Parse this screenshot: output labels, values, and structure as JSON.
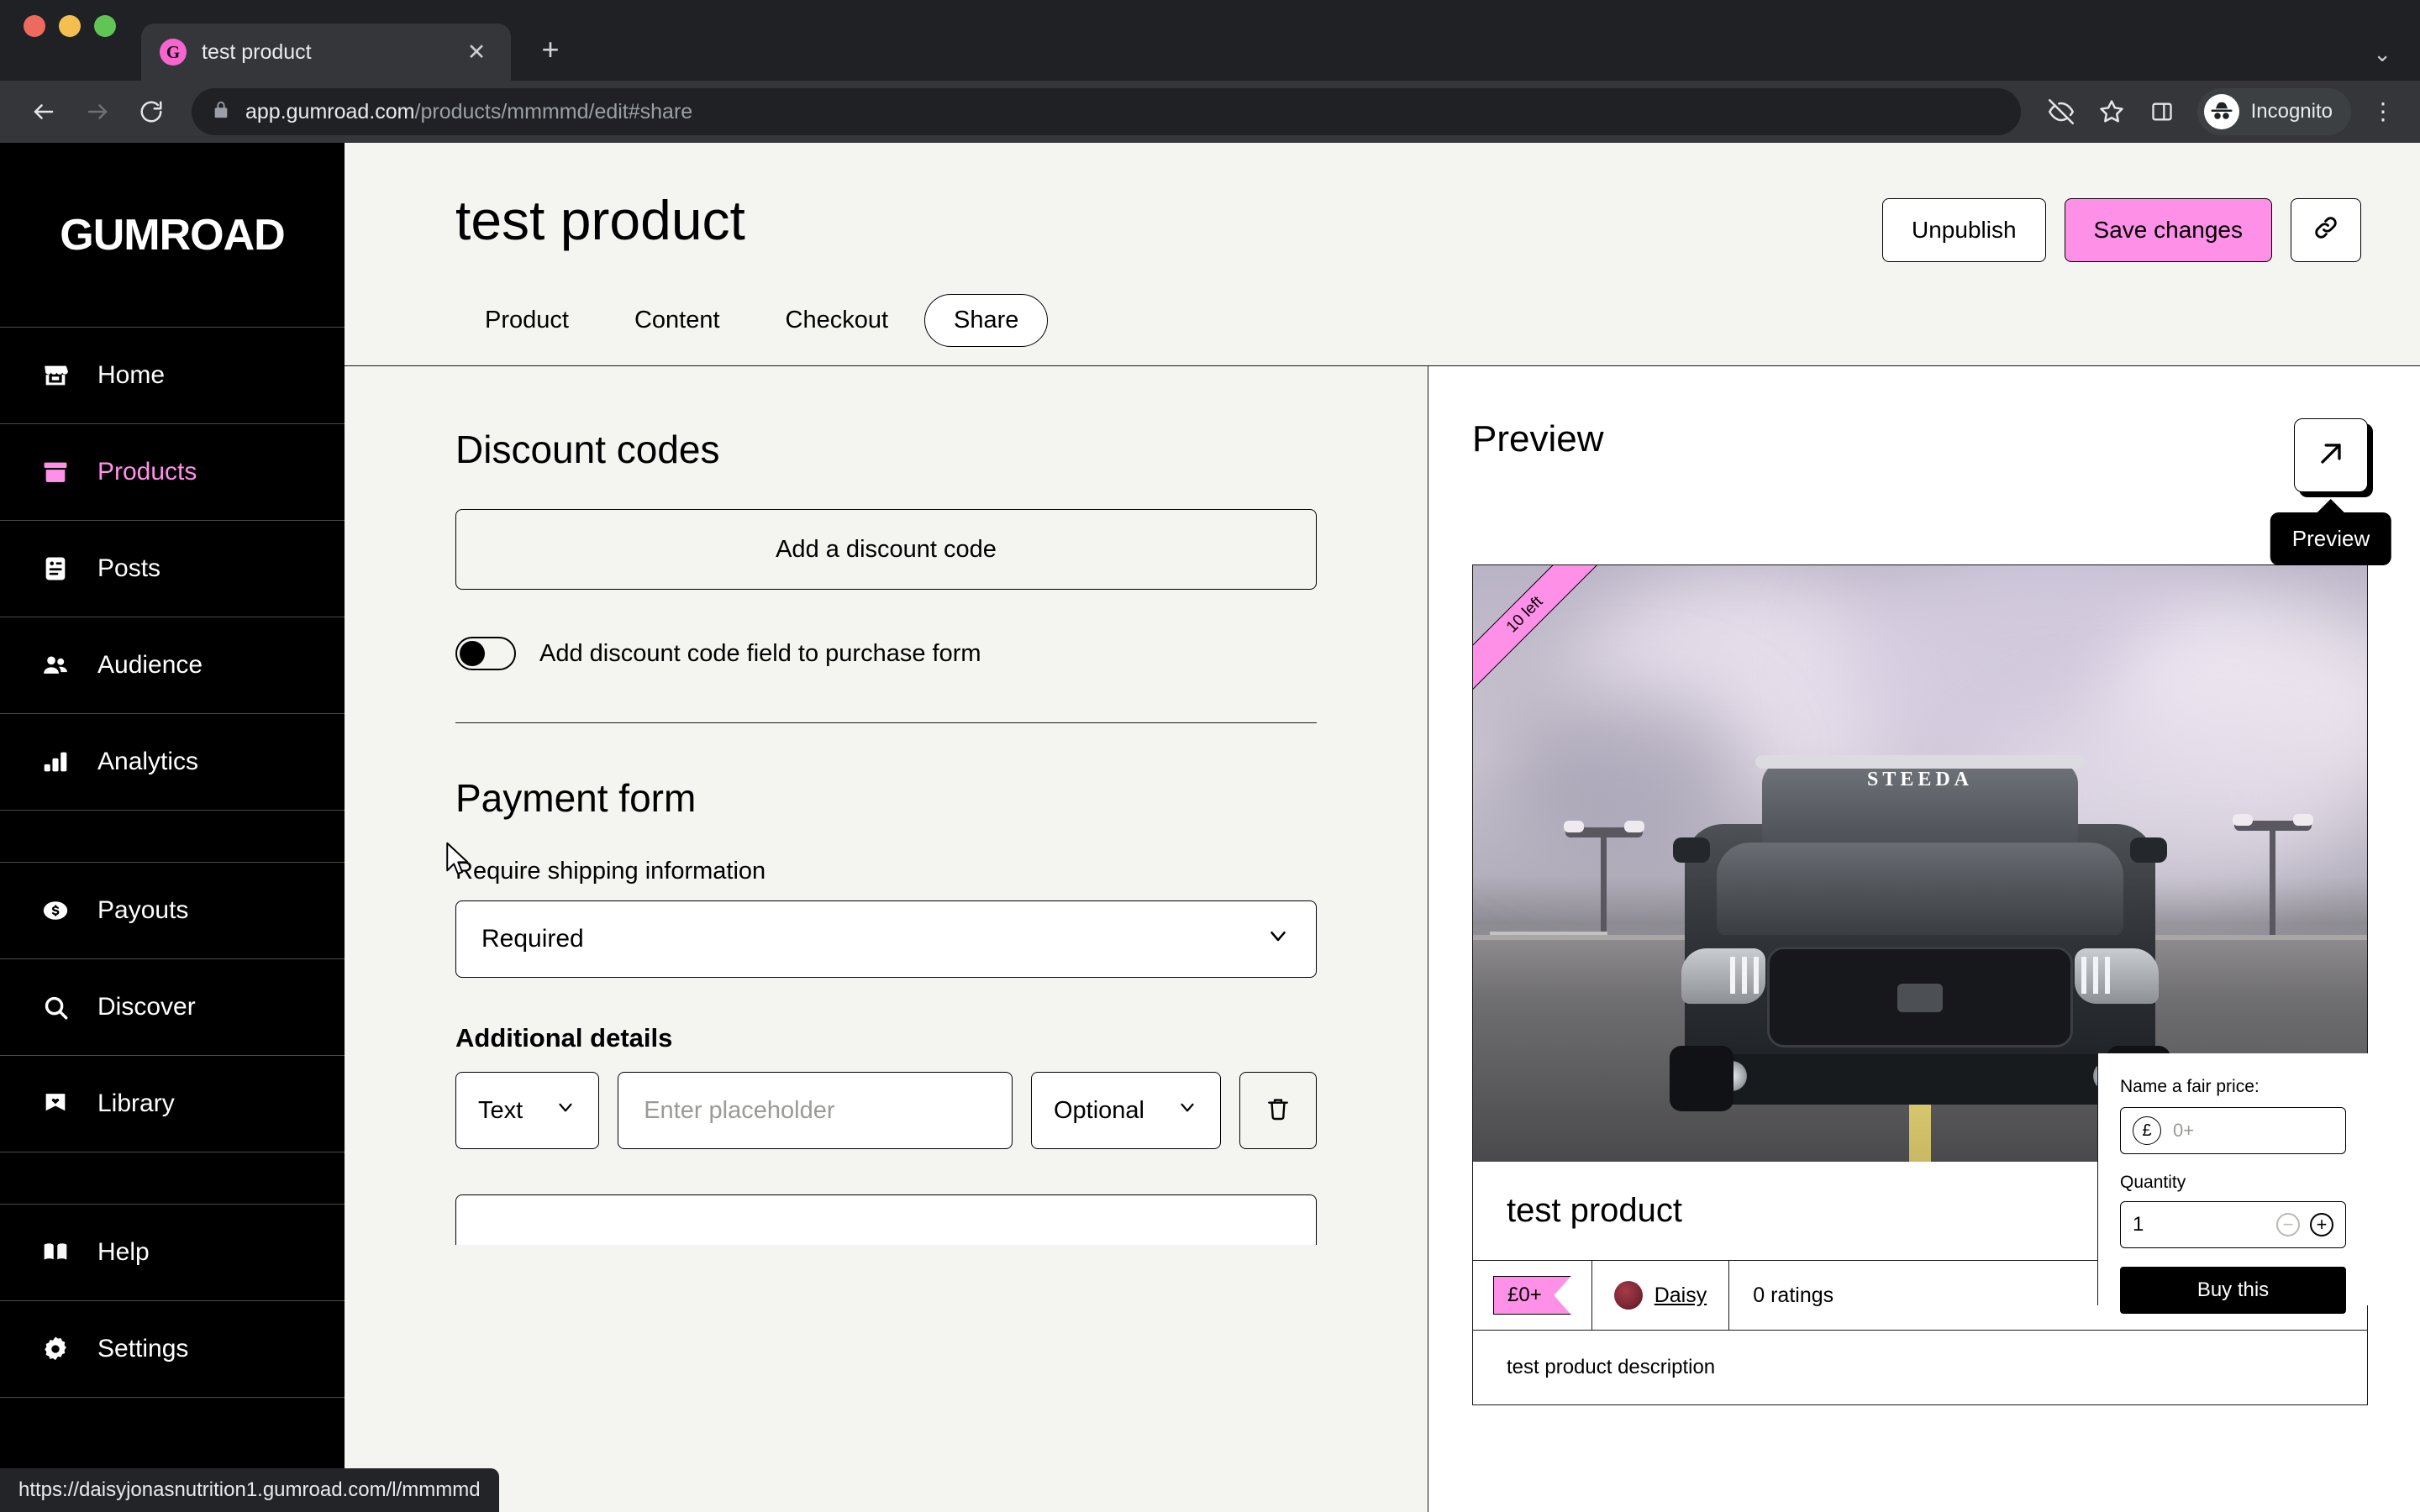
{
  "browser": {
    "tab": {
      "title": "test product",
      "favicon_letter": "G",
      "close_label": "✕"
    },
    "new_tab_label": "+",
    "tab_list_caret": "⌄",
    "url": {
      "host": "app.gumroad.com",
      "path": "/products/mmmmd/edit#share"
    },
    "profile_label": "Incognito",
    "status_url": "https://daisyjonasnutrition1.gumroad.com/l/mmmmd",
    "icons": {
      "back": "back-arrow-icon",
      "forward": "forward-arrow-icon",
      "reload": "reload-icon",
      "lock": "lock-icon",
      "tracking": "eye-off-icon",
      "bookmark": "star-icon",
      "sidepanel": "side-panel-icon",
      "menu": "kebab-menu-icon"
    }
  },
  "sidebar": {
    "brand": "GUMROAD",
    "items": [
      {
        "label": "Home",
        "icon": "storefront-icon",
        "active": false
      },
      {
        "label": "Products",
        "icon": "box-icon",
        "active": true
      },
      {
        "label": "Posts",
        "icon": "document-icon",
        "active": false
      },
      {
        "label": "Audience",
        "icon": "people-icon",
        "active": false
      },
      {
        "label": "Analytics",
        "icon": "bar-chart-icon",
        "active": false
      },
      {
        "label": "Payouts",
        "icon": "dollar-coin-icon",
        "active": false
      },
      {
        "label": "Discover",
        "icon": "search-icon",
        "active": false
      },
      {
        "label": "Library",
        "icon": "bookmark-heart-icon",
        "active": false
      },
      {
        "label": "Help",
        "icon": "book-icon",
        "active": false
      },
      {
        "label": "Settings",
        "icon": "gear-icon",
        "active": false
      }
    ]
  },
  "header": {
    "title": "test product",
    "unpublish_label": "Unpublish",
    "save_label": "Save changes",
    "link_icon": "link-icon",
    "tabs": [
      {
        "label": "Product",
        "selected": false
      },
      {
        "label": "Content",
        "selected": false
      },
      {
        "label": "Checkout",
        "selected": false
      },
      {
        "label": "Share",
        "selected": true
      }
    ]
  },
  "form": {
    "discount_section_title": "Discount codes",
    "add_discount_label": "Add a discount code",
    "toggle_label": "Add discount code field to purchase form",
    "toggle_on": false,
    "payment_section_title": "Payment form",
    "shipping_label": "Require shipping information",
    "shipping_value": "Required",
    "additional_details_title": "Additional details",
    "detail_type_value": "Text",
    "detail_placeholder": "Enter placeholder",
    "detail_required_value": "Optional",
    "delete_icon": "trash-icon"
  },
  "preview": {
    "title": "Preview",
    "button_icon": "external-link-arrow-icon",
    "tooltip": "Preview",
    "ribbon": "10 left",
    "product_name": "test product",
    "price": "£0+",
    "author": "Daisy",
    "ratings": "0 ratings",
    "description": "test product description",
    "hero_decal": "STEEDA"
  },
  "buybox": {
    "price_label": "Name a fair price:",
    "currency_symbol": "£",
    "price_placeholder": "0+",
    "quantity_label": "Quantity",
    "quantity_value": "1",
    "decrement_label": "−",
    "increment_label": "+",
    "buy_label": "Buy this"
  },
  "colors": {
    "accent_pink": "#FF90E8",
    "page_bg": "#F4F4F0",
    "sidebar_bg": "#000000"
  }
}
